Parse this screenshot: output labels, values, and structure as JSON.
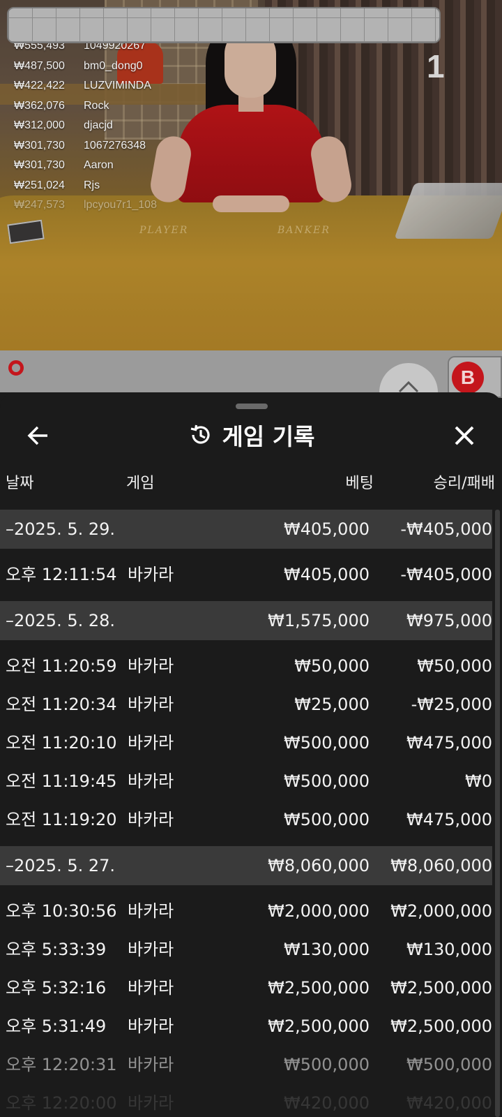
{
  "video": {
    "round_number": "1",
    "table_labels": {
      "player": "PLAYER",
      "banker": "BANKER"
    },
    "winners": [
      {
        "amount": "₩555,493",
        "name": "1049920267"
      },
      {
        "amount": "₩487,500",
        "name": "bm0_dong0"
      },
      {
        "amount": "₩422,422",
        "name": "LUZVIMINDA"
      },
      {
        "amount": "₩362,076",
        "name": "Rock"
      },
      {
        "amount": "₩312,000",
        "name": "djacjd"
      },
      {
        "amount": "₩301,730",
        "name": "1067276348"
      },
      {
        "amount": "₩301,730",
        "name": "Aaron"
      },
      {
        "amount": "₩251,024",
        "name": "Rjs"
      },
      {
        "amount": "₩247,573",
        "name": "lpcyou7r1_108"
      }
    ]
  },
  "roadmap": {
    "banker_badge": "B"
  },
  "sheet": {
    "title": "게임 기록",
    "icons": {
      "back": "arrow-left-icon",
      "history": "history-icon",
      "close": "close-icon"
    },
    "columns": {
      "date": "날짜",
      "game": "게임",
      "bet": "베팅",
      "result": "승리/패배"
    },
    "groups": [
      {
        "date": "–2025. 5. 29.",
        "bet": "₩405,000",
        "result": "-₩405,000",
        "items": [
          {
            "time": "오후 12:11:54",
            "game": "바카라",
            "bet": "₩405,000",
            "result": "-₩405,000"
          }
        ]
      },
      {
        "date": "–2025. 5. 28.",
        "bet": "₩1,575,000",
        "result": "₩975,000",
        "items": [
          {
            "time": "오전 11:20:59",
            "game": "바카라",
            "bet": "₩50,000",
            "result": "₩50,000"
          },
          {
            "time": "오전 11:20:34",
            "game": "바카라",
            "bet": "₩25,000",
            "result": "-₩25,000"
          },
          {
            "time": "오전 11:20:10",
            "game": "바카라",
            "bet": "₩500,000",
            "result": "₩475,000"
          },
          {
            "time": "오전 11:19:45",
            "game": "바카라",
            "bet": "₩500,000",
            "result": "₩0"
          },
          {
            "time": "오전 11:19:20",
            "game": "바카라",
            "bet": "₩500,000",
            "result": "₩475,000"
          }
        ]
      },
      {
        "date": "–2025. 5. 27.",
        "bet": "₩8,060,000",
        "result": "₩8,060,000",
        "items": [
          {
            "time": "오후 10:30:56",
            "game": "바카라",
            "bet": "₩2,000,000",
            "result": "₩2,000,000"
          },
          {
            "time": "오후 5:33:39",
            "game": "바카라",
            "bet": "₩130,000",
            "result": "₩130,000"
          },
          {
            "time": "오후 5:32:16",
            "game": "바카라",
            "bet": "₩2,500,000",
            "result": "₩2,500,000"
          },
          {
            "time": "오후 5:31:49",
            "game": "바카라",
            "bet": "₩2,500,000",
            "result": "₩2,500,000"
          },
          {
            "time": "오후 12:20:31",
            "game": "바카라",
            "bet": "₩500,000",
            "result": "₩500,000"
          },
          {
            "time": "오후 12:20:00",
            "game": "바카라",
            "bet": "₩420,000",
            "result": "₩420,000"
          }
        ]
      }
    ]
  }
}
